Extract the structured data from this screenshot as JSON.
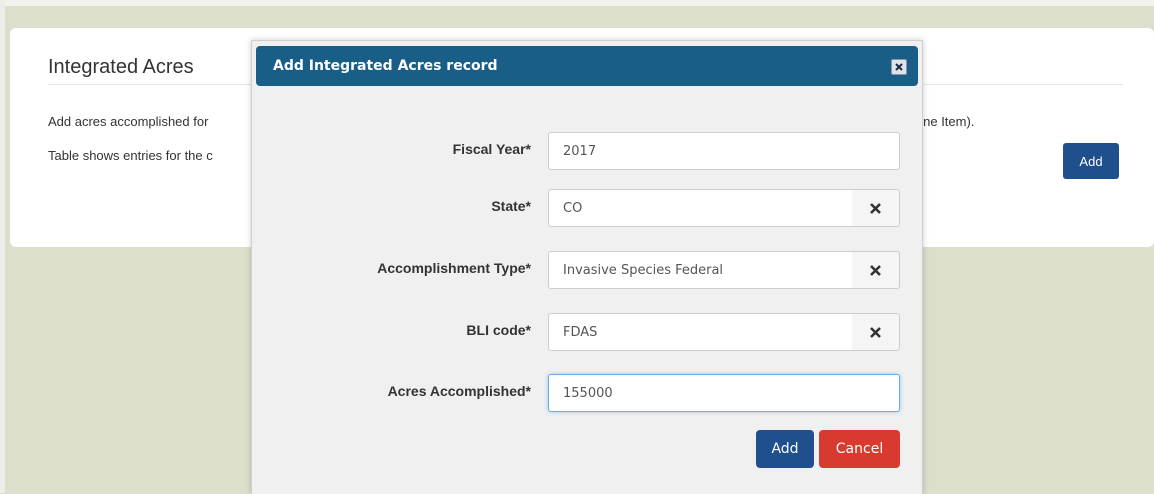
{
  "page": {
    "title": "Integrated Acres",
    "line1": "Add acres accomplished for",
    "line1_tail": "Line Item).",
    "line2": "Table shows entries for the c",
    "add_label": "Add"
  },
  "modal": {
    "title": "Add Integrated Acres record",
    "fields": [
      {
        "label": "Fiscal Year*",
        "value": "2017",
        "clearable": false
      },
      {
        "label": "State*",
        "value": "CO",
        "clearable": true
      },
      {
        "label": "Accomplishment Type*",
        "value": "Invasive Species Federal",
        "clearable": true
      },
      {
        "label": "BLI code*",
        "value": "FDAS",
        "clearable": true
      },
      {
        "label": "Acres Accomplished*",
        "value": "155000",
        "clearable": false,
        "focused": true
      }
    ],
    "add_label": "Add",
    "cancel_label": "Cancel"
  },
  "colors": {
    "background": "#dcdfcb",
    "header": "#195e86",
    "primary_button": "#1f4f8c",
    "danger_button": "#d83a2f"
  },
  "icons": {
    "close": "close-icon",
    "clear": "clear-x-icon"
  }
}
